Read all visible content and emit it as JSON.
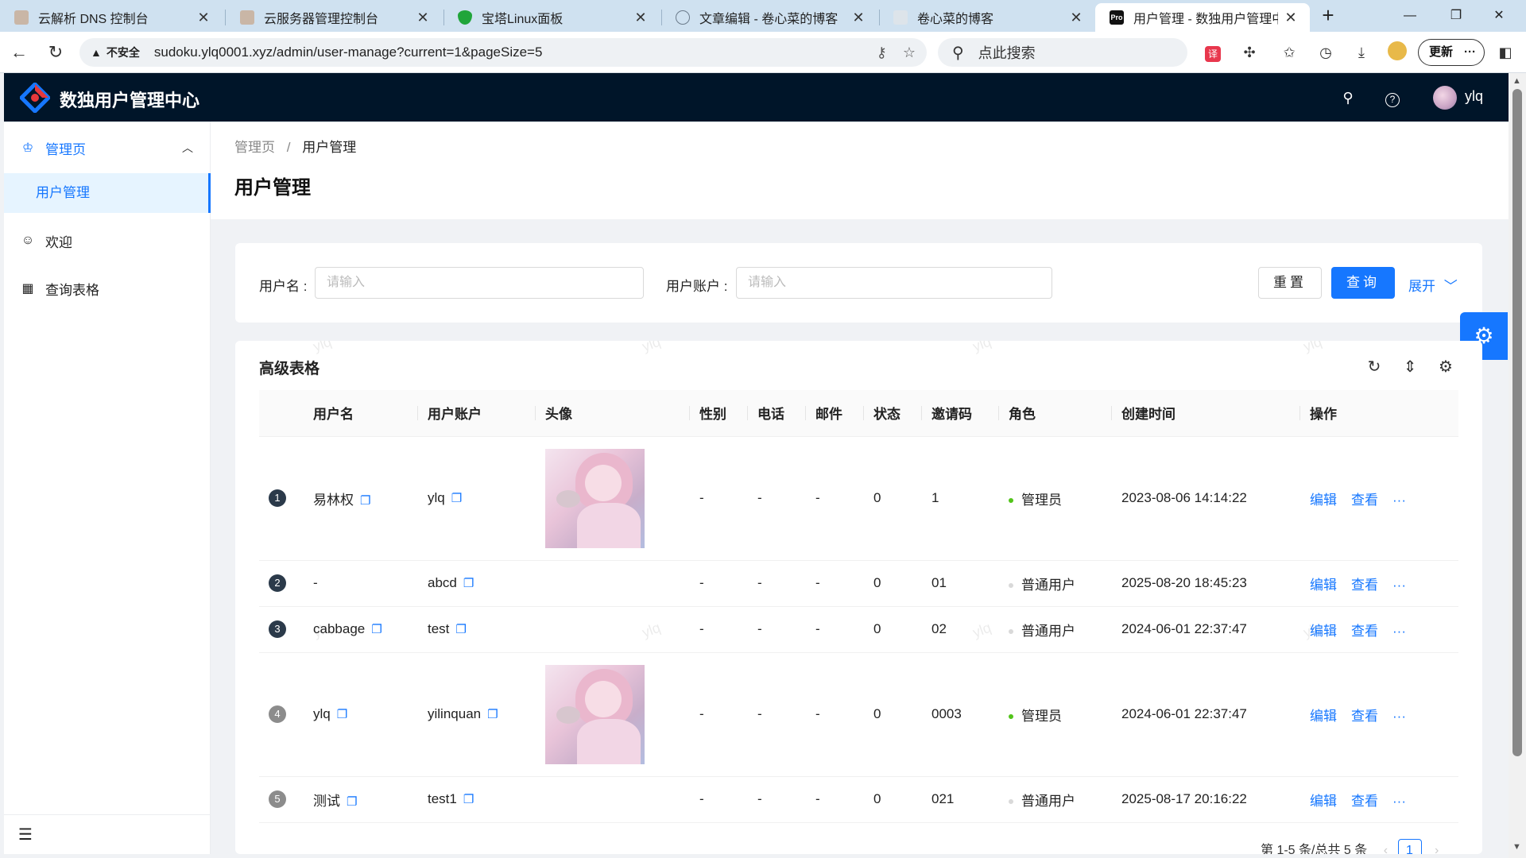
{
  "browser": {
    "tabs": [
      {
        "title": "云解析 DNS 控制台",
        "favicon_color": "#c9b6a6"
      },
      {
        "title": "云服务器管理控制台",
        "favicon_color": "#c9b6a6"
      },
      {
        "title": "宝塔Linux面板",
        "favicon_color": "#20a53a"
      },
      {
        "title": "文章编辑 - 卷心菜的博客",
        "favicon_color": "#6b7b8b"
      },
      {
        "title": "卷心菜的博客",
        "favicon_color": "#8899aa"
      },
      {
        "title": "用户管理 - 数独用户管理中心",
        "favicon_color": "#111111",
        "favicon_text": "Pro"
      }
    ],
    "address": {
      "security_label": "不安全",
      "url": "sudoku.ylq0001.xyz/admin/user-manage?current=1&pageSize=5"
    },
    "search_placeholder": "点此搜索",
    "update_label": "更新",
    "update_more": "···"
  },
  "app": {
    "title": "数独用户管理中心",
    "username": "ylq"
  },
  "sidebar": {
    "group_label": "管理页",
    "sub_item": "用户管理",
    "items": [
      "欢迎",
      "查询表格"
    ]
  },
  "page": {
    "breadcrumb_root": "管理页",
    "breadcrumb_sep": "/",
    "breadcrumb_current": "用户管理",
    "title": "用户管理"
  },
  "filter": {
    "username_label": "用户名 :",
    "username_placeholder": "请输入",
    "account_label": "用户账户 :",
    "account_placeholder": "请输入",
    "reset_label": "重置",
    "query_label": "查询",
    "expand_label": "展开"
  },
  "table": {
    "card_title": "高级表格",
    "watermark": "ylq",
    "columns": [
      "",
      "用户名",
      "用户账户",
      "头像",
      "性别",
      "电话",
      "邮件",
      "状态",
      "邀请码",
      "角色",
      "创建时间",
      "操作"
    ],
    "rows": [
      {
        "index": "1",
        "username": "易林权",
        "username_copy": true,
        "account": "ylq",
        "has_avatar": true,
        "gender": "-",
        "phone": "-",
        "email": "-",
        "status": "0",
        "invite": "1",
        "role": "管理员",
        "role_color": "#52c41a",
        "created": "2023-08-06 14:14:22"
      },
      {
        "index": "2",
        "username": "-",
        "username_copy": false,
        "account": "abcd",
        "has_avatar": false,
        "gender": "-",
        "phone": "-",
        "email": "-",
        "status": "0",
        "invite": "01",
        "role": "普通用户",
        "role_color": "#d9d9d9",
        "created": "2025-08-20 18:45:23"
      },
      {
        "index": "3",
        "username": "cabbage",
        "username_copy": true,
        "account": "test",
        "has_avatar": false,
        "gender": "-",
        "phone": "-",
        "email": "-",
        "status": "0",
        "invite": "02",
        "role": "普通用户",
        "role_color": "#d9d9d9",
        "created": "2024-06-01 22:37:47"
      },
      {
        "index": "4",
        "username": "ylq",
        "username_copy": true,
        "account": "yilinquan",
        "has_avatar": true,
        "gender": "-",
        "phone": "-",
        "email": "-",
        "status": "0",
        "invite": "0003",
        "role": "管理员",
        "role_color": "#52c41a",
        "created": "2024-06-01 22:37:47"
      },
      {
        "index": "5",
        "username": "测试",
        "username_copy": true,
        "account": "test1",
        "has_avatar": false,
        "gender": "-",
        "phone": "-",
        "email": "-",
        "status": "0",
        "invite": "021",
        "role": "普通用户",
        "role_color": "#d9d9d9",
        "created": "2025-08-17 20:16:22"
      }
    ],
    "actions": {
      "edit": "编辑",
      "view": "查看",
      "more": "···"
    },
    "pagination": {
      "summary": "第 1-5 条/总共 5 条",
      "current_page": "1"
    }
  },
  "colors": {
    "primary": "#1677ff",
    "header_bg": "#001529",
    "index_dark": "#2b3a4a",
    "index_light": "#8c8c8c"
  }
}
